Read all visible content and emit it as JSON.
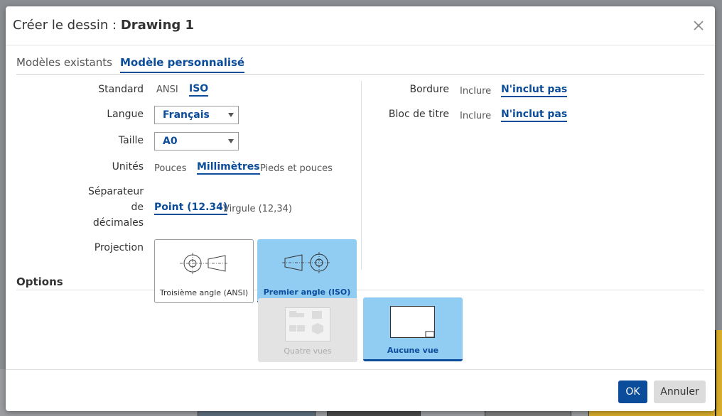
{
  "dialog": {
    "title_prefix": "Créer le dessin :",
    "title_name": "Drawing 1",
    "close_icon": "close-icon"
  },
  "tabs": [
    {
      "label": "Modèles existants",
      "selected": false
    },
    {
      "label": "Modèle personnalisé",
      "selected": true
    }
  ],
  "form": {
    "standard": {
      "label": "Standard",
      "options": [
        "ANSI",
        "ISO"
      ],
      "selected": "ISO"
    },
    "language": {
      "label": "Langue",
      "value": "Français"
    },
    "size": {
      "label": "Taille",
      "value": "A0"
    },
    "units": {
      "label": "Unités",
      "options": [
        "Pouces",
        "Millimètres",
        "Pieds et pouces"
      ],
      "selected": "Millimètres"
    },
    "decimal_separator": {
      "label_lines": [
        "Séparateur",
        "de",
        "décimales"
      ],
      "options": [
        "Point (12.34)",
        "Virgule (12,34)"
      ],
      "selected": "Point (12.34)"
    },
    "projection": {
      "label": "Projection",
      "options": [
        "Troisième angle (ANSI)",
        "Premier angle (ISO)"
      ],
      "selected": "Premier angle (ISO)"
    },
    "border": {
      "label": "Bordure",
      "options": [
        "Inclure",
        "N'inclut pas"
      ],
      "selected": "N'inclut pas"
    },
    "title_block": {
      "label": "Bloc de titre",
      "options": [
        "Inclure",
        "N'inclut pas"
      ],
      "selected": "N'inclut pas"
    }
  },
  "options": {
    "title": "Options",
    "views": [
      {
        "label": "Quatre vues",
        "enabled": false,
        "selected": false
      },
      {
        "label": "Aucune vue",
        "enabled": true,
        "selected": true
      }
    ]
  },
  "buttons": {
    "ok": "OK",
    "cancel": "Annuler"
  },
  "colors": {
    "accent": "#0b4c9b",
    "selected_fill": "#91ccf2"
  }
}
